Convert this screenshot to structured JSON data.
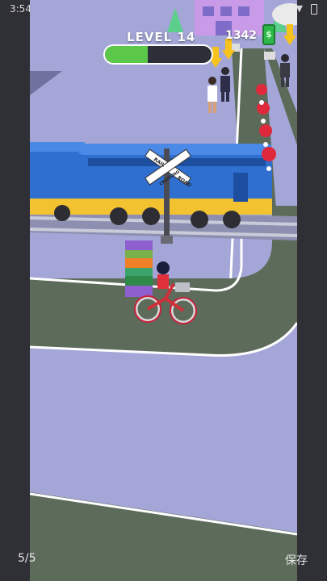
{
  "status_bar": {
    "time": "3:54",
    "notification_icon": "app-notification-icon",
    "wifi_icon": "wifi-icon",
    "battery_icon": "battery-icon"
  },
  "hud": {
    "level_label": "LEVEL 14",
    "level_progress": 0.4,
    "money": "1342",
    "money_icon": "cash-icon",
    "progress_color": "#5cc84a"
  },
  "scene": {
    "crossing_sign_line1": "RAIL",
    "crossing_sign_line2": "ROAD",
    "crossing_sign_center": "CROSSING",
    "train_color": "#2f6fd0",
    "marker_color": "#e0283c"
  },
  "footer": {
    "pager": "5/5",
    "save_label": "保存"
  }
}
